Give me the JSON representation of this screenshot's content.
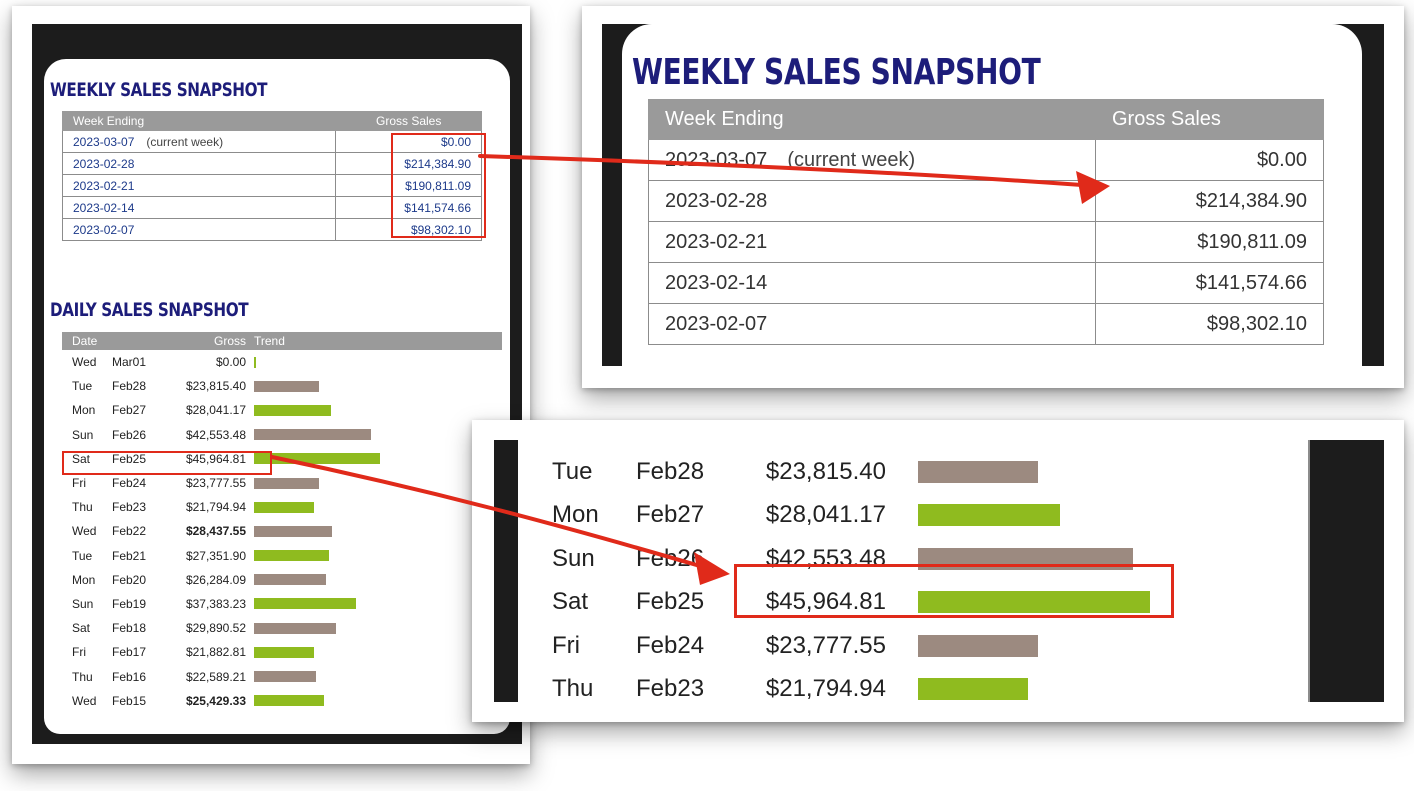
{
  "colors": {
    "heading": "#1d1d7a",
    "header_bg": "#9a9a9a",
    "bar_brown": "#9c8a80",
    "bar_green": "#8fbb1f",
    "highlight": "#e02a1a"
  },
  "weekly": {
    "title": "WEEKLY SALES SNAPSHOT",
    "col_week": "Week Ending",
    "col_gross": "Gross Sales",
    "rows": [
      {
        "week": "2023-03-07",
        "note": "(current week)",
        "gross": "$0.00"
      },
      {
        "week": "2023-02-28",
        "note": "",
        "gross": "$214,384.90"
      },
      {
        "week": "2023-02-21",
        "note": "",
        "gross": "$190,811.09"
      },
      {
        "week": "2023-02-14",
        "note": "",
        "gross": "$141,574.66"
      },
      {
        "week": "2023-02-07",
        "note": "",
        "gross": "$98,302.10"
      }
    ]
  },
  "daily": {
    "title": "DAILY SALES SNAPSHOT",
    "col_date": "Date",
    "col_gross": "Gross",
    "col_trend": "Trend",
    "rows": [
      {
        "day": "Wed",
        "date": "Mar01",
        "gross": "$0.00",
        "value": 0,
        "bold": false,
        "color": "green"
      },
      {
        "day": "Tue",
        "date": "Feb28",
        "gross": "$23,815.40",
        "value": 23815.4,
        "bold": false,
        "color": "brown"
      },
      {
        "day": "Mon",
        "date": "Feb27",
        "gross": "$28,041.17",
        "value": 28041.17,
        "bold": false,
        "color": "green"
      },
      {
        "day": "Sun",
        "date": "Feb26",
        "gross": "$42,553.48",
        "value": 42553.48,
        "bold": false,
        "color": "brown"
      },
      {
        "day": "Sat",
        "date": "Feb25",
        "gross": "$45,964.81",
        "value": 45964.81,
        "bold": false,
        "color": "green"
      },
      {
        "day": "Fri",
        "date": "Feb24",
        "gross": "$23,777.55",
        "value": 23777.55,
        "bold": false,
        "color": "brown"
      },
      {
        "day": "Thu",
        "date": "Feb23",
        "gross": "$21,794.94",
        "value": 21794.94,
        "bold": false,
        "color": "green"
      },
      {
        "day": "Wed",
        "date": "Feb22",
        "gross": "$28,437.55",
        "value": 28437.55,
        "bold": true,
        "color": "brown"
      },
      {
        "day": "Tue",
        "date": "Feb21",
        "gross": "$27,351.90",
        "value": 27351.9,
        "bold": false,
        "color": "green"
      },
      {
        "day": "Mon",
        "date": "Feb20",
        "gross": "$26,284.09",
        "value": 26284.09,
        "bold": false,
        "color": "brown"
      },
      {
        "day": "Sun",
        "date": "Feb19",
        "gross": "$37,383.23",
        "value": 37383.23,
        "bold": false,
        "color": "green"
      },
      {
        "day": "Sat",
        "date": "Feb18",
        "gross": "$29,890.52",
        "value": 29890.52,
        "bold": false,
        "color": "brown"
      },
      {
        "day": "Fri",
        "date": "Feb17",
        "gross": "$21,882.81",
        "value": 21882.81,
        "bold": false,
        "color": "green"
      },
      {
        "day": "Thu",
        "date": "Feb16",
        "gross": "$22,589.21",
        "value": 22589.21,
        "bold": false,
        "color": "brown"
      },
      {
        "day": "Wed",
        "date": "Feb15",
        "gross": "$25,429.33",
        "value": 25429.33,
        "bold": true,
        "color": "green"
      }
    ]
  },
  "zoom_weekly": {
    "title": "WEEKLY SALES SNAPSHOT",
    "col_week": "Week Ending",
    "col_gross": "Gross Sales",
    "rows": [
      {
        "week": "2023-03-07",
        "note": "(current week)",
        "gross": "$0.00"
      },
      {
        "week": "2023-02-28",
        "note": "",
        "gross": "$214,384.90"
      },
      {
        "week": "2023-02-21",
        "note": "",
        "gross": "$190,811.09"
      },
      {
        "week": "2023-02-14",
        "note": "",
        "gross": "$141,574.66"
      },
      {
        "week": "2023-02-07",
        "note": "",
        "gross": "$98,302.10"
      }
    ]
  },
  "zoom_daily": {
    "rows": [
      {
        "day": "Tue",
        "date": "Feb28",
        "gross": "$23,815.40",
        "value": 23815.4,
        "color": "brown"
      },
      {
        "day": "Mon",
        "date": "Feb27",
        "gross": "$28,041.17",
        "value": 28041.17,
        "color": "green"
      },
      {
        "day": "Sun",
        "date": "Feb26",
        "gross": "$42,553.48",
        "value": 42553.48,
        "color": "brown"
      },
      {
        "day": "Sat",
        "date": "Feb25",
        "gross": "$45,964.81",
        "value": 45964.81,
        "color": "green"
      },
      {
        "day": "Fri",
        "date": "Feb24",
        "gross": "$23,777.55",
        "value": 23777.55,
        "color": "brown"
      },
      {
        "day": "Thu",
        "date": "Feb23",
        "gross": "$21,794.94",
        "value": 21794.94,
        "color": "green"
      }
    ]
  }
}
